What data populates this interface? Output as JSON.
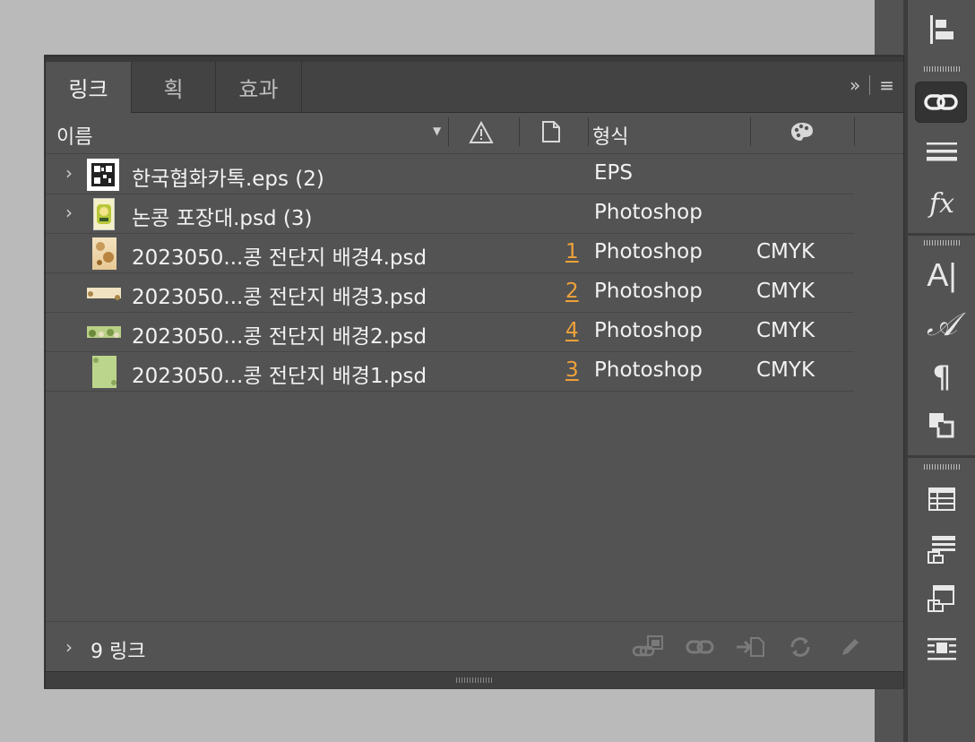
{
  "tabs": [
    {
      "label": "링크"
    },
    {
      "label": "획"
    },
    {
      "label": "효과"
    }
  ],
  "tab_tools": {
    "expand": "»",
    "menu": "≡"
  },
  "columns": {
    "name": "이름",
    "format": "형식"
  },
  "rows": [
    {
      "name": "한국협화카톡.eps (2)",
      "page": "",
      "format": "EPS",
      "color": "",
      "expandable": true
    },
    {
      "name": "논콩 포장대.psd (3)",
      "page": "",
      "format": "Photoshop",
      "color": "",
      "expandable": true
    },
    {
      "name": "2023050...콩 전단지 배경4.psd",
      "page": "1",
      "format": "Photoshop",
      "color": "CMYK",
      "expandable": false
    },
    {
      "name": "2023050...콩 전단지 배경3.psd",
      "page": "2",
      "format": "Photoshop",
      "color": "CMYK",
      "expandable": false
    },
    {
      "name": "2023050...콩 전단지 배경2.psd",
      "page": "4",
      "format": "Photoshop",
      "color": "CMYK",
      "expandable": false
    },
    {
      "name": "2023050...콩 전단지 배경1.psd",
      "page": "3",
      "format": "Photoshop",
      "color": "CMYK",
      "expandable": false
    }
  ],
  "footer": {
    "count": "9 링크"
  },
  "dock_items": [
    "align-icon",
    "links-icon",
    "stroke-icon",
    "fx-icon",
    "character-icon",
    "glyphs-icon",
    "paragraph-icon",
    "pathfinder-icon",
    "table-icon",
    "paragraph-styles-icon",
    "character-styles-icon",
    "text-wrap-icon"
  ],
  "colors": {
    "accent": "#f0a23a",
    "panel": "#535353",
    "tab_bg": "#434343"
  }
}
